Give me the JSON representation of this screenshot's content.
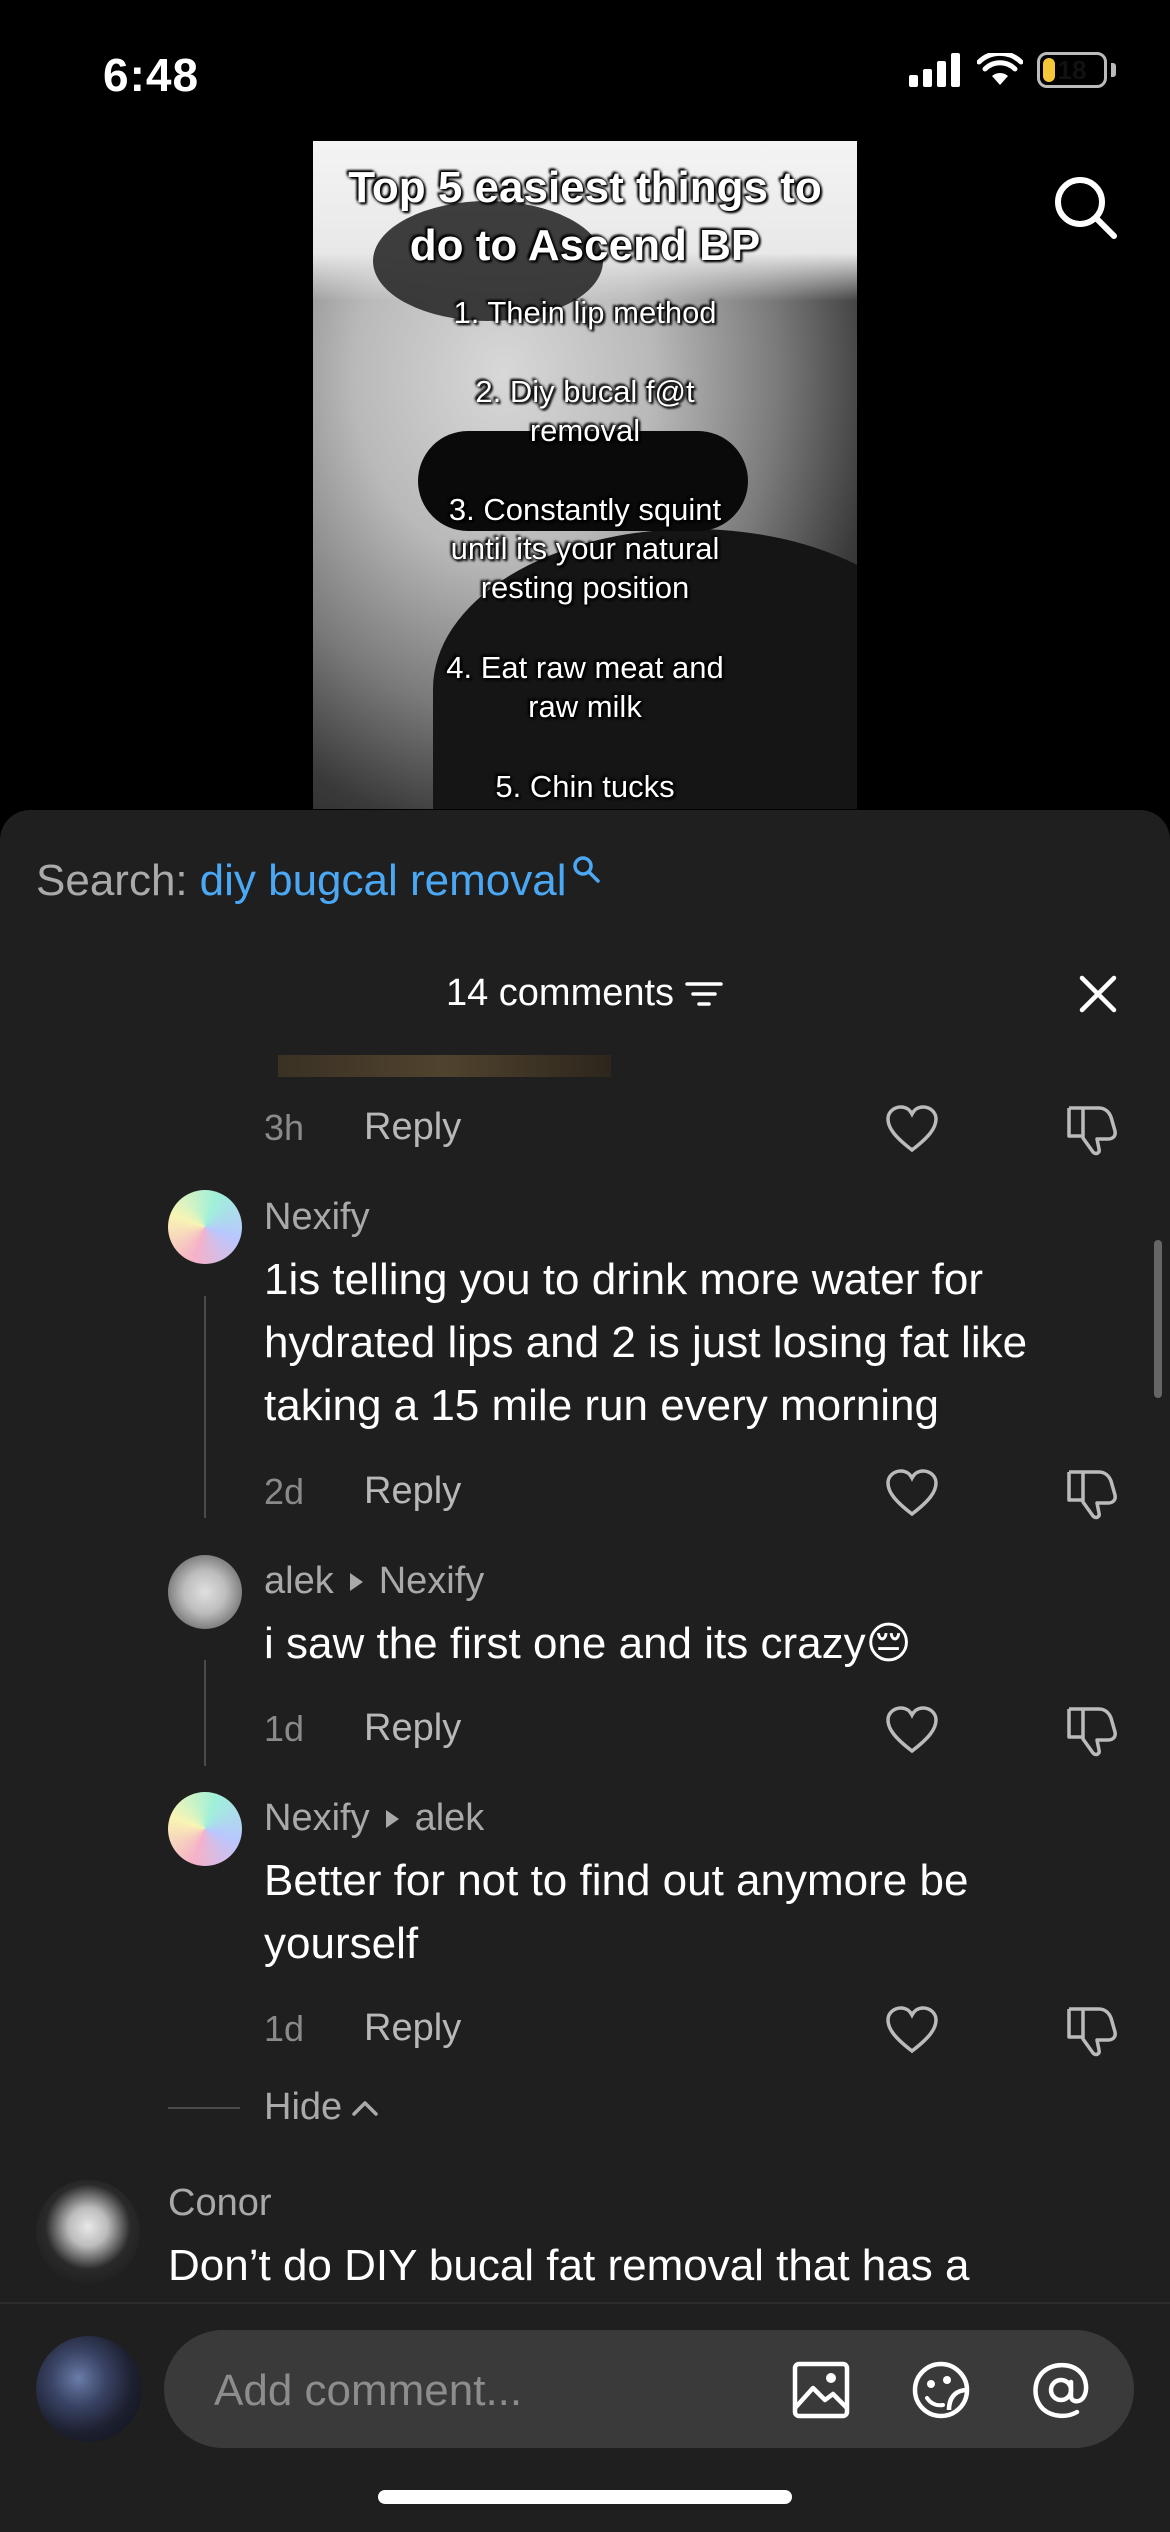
{
  "status": {
    "time": "6:48",
    "battery": "18"
  },
  "video": {
    "title": "Top 5 easiest things to do to Ascend BP",
    "items": [
      "1. Thein lip method",
      "2. Diy bucal f@t removal",
      "3. Constantly squint until its your natural resting position",
      "4. Eat raw meat and raw milk",
      "5. Chin tucks"
    ]
  },
  "search": {
    "label": "Search:",
    "query": "diy bugcal removal"
  },
  "comments_header": {
    "count_label": "14 comments"
  },
  "comments": [
    {
      "id": "peek",
      "time": "3h",
      "reply": "Reply"
    },
    {
      "id": "c1",
      "username": "Nexify",
      "text": "1is telling you to drink more water for hydrated lips and 2 is just losing fat like taking a 15 mile run every morning",
      "time": "2d",
      "reply": "Reply"
    },
    {
      "id": "c2",
      "username": "alek",
      "reply_to": "Nexify",
      "text": "i saw the first one and its crazy😔",
      "time": "1d",
      "reply": "Reply"
    },
    {
      "id": "c3",
      "username": "Nexify",
      "reply_to": "alek",
      "text": "Better for not to find out anymore be yourself",
      "time": "1d",
      "reply": "Reply"
    },
    {
      "id": "c4",
      "username": "Conor",
      "text": "Don’t do DIY bucal fat removal that has a"
    }
  ],
  "hide_label": "Hide",
  "input": {
    "placeholder": "Add comment..."
  },
  "colors": {
    "accent": "#4aa8f5",
    "sheet_bg": "#1f1f1f",
    "battery": "#f5c83a"
  }
}
